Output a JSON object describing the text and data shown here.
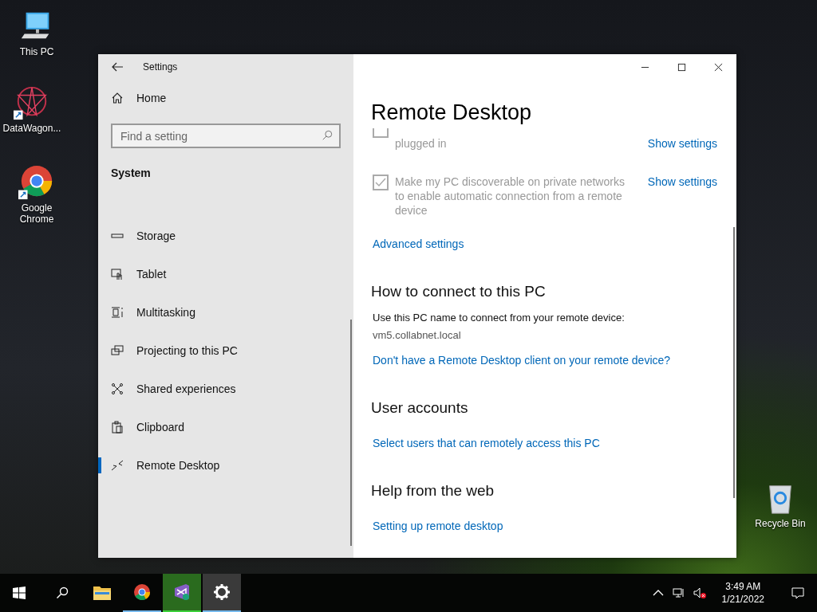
{
  "desktop_icons": [
    {
      "label": "This PC",
      "kind": "pc",
      "shortcut": false
    },
    {
      "label": "DataWagon...",
      "kind": "star",
      "shortcut": true
    },
    {
      "label": "Google Chrome",
      "kind": "chrome",
      "shortcut": true
    },
    {
      "label": "Recycle Bin",
      "kind": "bin",
      "shortcut": false
    }
  ],
  "window": {
    "title": "Settings",
    "nav": {
      "home": "Home",
      "search": {
        "placeholder": "Find a setting"
      },
      "section": "System",
      "items": [
        {
          "label": "Storage",
          "kind": "storage",
          "selected": false
        },
        {
          "label": "Tablet",
          "kind": "tablet",
          "selected": false
        },
        {
          "label": "Multitasking",
          "kind": "multitask",
          "selected": false
        },
        {
          "label": "Projecting to this PC",
          "kind": "project",
          "selected": false
        },
        {
          "label": "Shared experiences",
          "kind": "shared",
          "selected": false
        },
        {
          "label": "Clipboard",
          "kind": "clipboard",
          "selected": false
        },
        {
          "label": "Remote Desktop",
          "kind": "remote",
          "selected": true
        }
      ]
    },
    "content": {
      "heading": "Remote Desktop",
      "options": [
        {
          "text": "plugged in",
          "checked": false,
          "clipped": true,
          "link": "Show settings"
        },
        {
          "text": "Make my PC discoverable on private networks to enable automatic connection from a remote device",
          "checked": true,
          "clipped": false,
          "link": "Show settings"
        }
      ],
      "advanced_link": "Advanced settings",
      "sections": [
        {
          "title": "How to connect to this PC",
          "lines": [
            "Use this PC name to connect from your remote device:",
            "vm5.collabnet.local"
          ],
          "link": "Don't have a Remote Desktop client on your remote device?"
        },
        {
          "title": "User accounts",
          "link": "Select users that can remotely access this PC"
        },
        {
          "title": "Help from the web",
          "link": "Setting up remote desktop"
        }
      ]
    }
  },
  "taskbar": {
    "apps": [
      {
        "kind": "explorer",
        "running": false,
        "flashing": false,
        "selected": false
      },
      {
        "kind": "chrome",
        "running": true,
        "flashing": false,
        "selected": false
      },
      {
        "kind": "vs",
        "running": true,
        "flashing": true,
        "selected": false
      },
      {
        "kind": "settings",
        "running": true,
        "flashing": false,
        "selected": true
      }
    ],
    "time": "3:49 AM",
    "date": "1/21/2022"
  }
}
